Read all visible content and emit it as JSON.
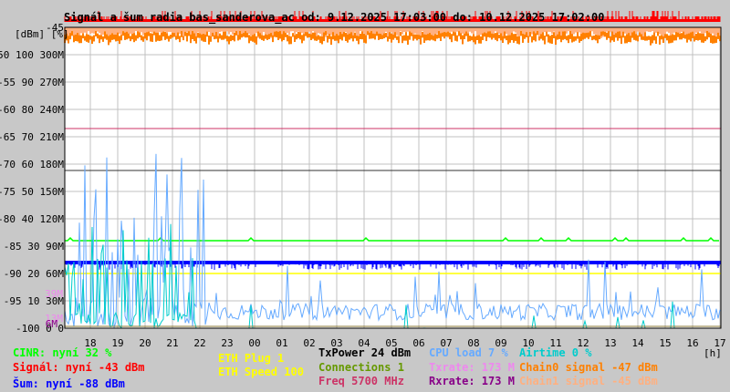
{
  "title": "Signál a šum radia bas_sanderova_ac od: 9.12.2025 17:03:00 do: 10.12.2025 17:02:00",
  "axis_header": "[dBm] [%]",
  "x_unit": "[h]",
  "colors": {
    "cinr": "#00ff00",
    "signal": "#ff0000",
    "noise": "#0000ff",
    "eth": "#ffff00",
    "txpower": "#000000",
    "connections": "#669900",
    "freq": "#cc3366",
    "cpu": "#66aaff",
    "txrate": "#ee88ee",
    "rxrate": "#880088",
    "airtime": "#00cccc",
    "chain0": "#ff8000",
    "chain1": "#ffb080"
  },
  "legend": {
    "cinr": "CINR: nyní 32 %",
    "signal": "Signál: nyní -43 dBm",
    "noise": "Šum: nyní -88 dBm",
    "eth_plug": "ETH Plug 1",
    "eth_speed": "ETH Speed 100",
    "txpower": "TxPower 24 dBm",
    "connections": "Connections 1",
    "freq": "Freq 5700 MHz",
    "cpu": "CPU load 7 %",
    "txrate": "Txrate: 173 M",
    "rxrate": "Rxrate: 173 M",
    "airtime": "Airtime 0 %",
    "chain0": "Chain0 signal -47 dBm",
    "chain1": "Chain1 signal -45 dBm"
  },
  "chart_data": {
    "type": "line",
    "title": "Signál a šum radia bas_sanderova_ac od: 9.12.2025 17:03:00 do: 10.12.2025 17:02:00",
    "xlabel": "[h]",
    "x_ticks": [
      "18",
      "19",
      "20",
      "21",
      "22",
      "23",
      "00",
      "01",
      "02",
      "03",
      "04",
      "05",
      "06",
      "07",
      "08",
      "09",
      "10",
      "11",
      "12",
      "13",
      "14",
      "15",
      "16",
      "17"
    ],
    "y_ticks_dbm": [
      "-45",
      "-50",
      "-55",
      "-60",
      "-65",
      "-70",
      "-75",
      "-80",
      "-85",
      "-90",
      "-95",
      "-100"
    ],
    "y_ticks_pct": [
      "100",
      "90",
      "80",
      "70",
      "60",
      "50",
      "40",
      "30",
      "20",
      "10",
      "0"
    ],
    "y_ticks_rate": [
      "300M",
      "270M",
      "240M",
      "210M",
      "180M",
      "150M",
      "120M",
      "90M",
      "60M",
      "30M",
      "0"
    ],
    "extra_labels": [
      "39M",
      "13M",
      "6M"
    ],
    "ylim_dbm": [
      -100,
      -45
    ],
    "grid": true,
    "series": [
      {
        "name": "CINR",
        "unit": "%",
        "level": 32
      },
      {
        "name": "Signál",
        "unit": "dBm",
        "level": -43
      },
      {
        "name": "Šum",
        "unit": "dBm",
        "level": -88
      },
      {
        "name": "Chain0 signal",
        "unit": "dBm",
        "level": -47
      },
      {
        "name": "Chain1 signal",
        "unit": "dBm",
        "level": -45
      },
      {
        "name": "ETH Speed",
        "unit": "M",
        "level": 60
      },
      {
        "name": "TxPower",
        "unit": "dBm",
        "level": 24
      },
      {
        "name": "CPU load",
        "unit": "%",
        "level": 7
      },
      {
        "name": "Airtime",
        "unit": "%",
        "level": 0
      }
    ]
  }
}
